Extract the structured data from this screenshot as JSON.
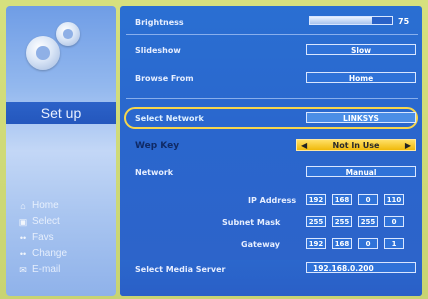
{
  "sidebar": {
    "title": "Set up",
    "menu": [
      {
        "icon": "home-icon",
        "label": "Home"
      },
      {
        "icon": "select-icon",
        "label": "Select"
      },
      {
        "icon": "fav-icon",
        "label": "Favs"
      },
      {
        "icon": "change-icon",
        "label": "Change"
      },
      {
        "icon": "email-icon",
        "label": "E-mail"
      }
    ]
  },
  "settings": {
    "brightness": {
      "label": "Brightness",
      "value": "75",
      "level": 0.75
    },
    "slideshow": {
      "label": "Slideshow",
      "value": "Slow"
    },
    "browse_from": {
      "label": "Browse From",
      "value": "Home"
    },
    "select_network": {
      "label": "Select Network",
      "value": "LINKSYS"
    },
    "wep_key": {
      "label": "Wep Key",
      "value": "Not In Use"
    },
    "network": {
      "label": "Network",
      "value": "Manual"
    },
    "ip_address": {
      "label": "IP Address",
      "values": [
        "192",
        "168",
        "0",
        "110"
      ]
    },
    "subnet_mask": {
      "label": "Subnet Mask",
      "values": [
        "255",
        "255",
        "255",
        "0"
      ]
    },
    "gateway": {
      "label": "Gateway",
      "values": [
        "192",
        "168",
        "0",
        "1"
      ]
    },
    "media_server": {
      "label": "Select Media Server",
      "value": "192.168.0.200"
    }
  },
  "colors": {
    "accent": "#2a6fd2",
    "highlight": "#f6d64d",
    "wep_bg": "#f0b90a"
  }
}
